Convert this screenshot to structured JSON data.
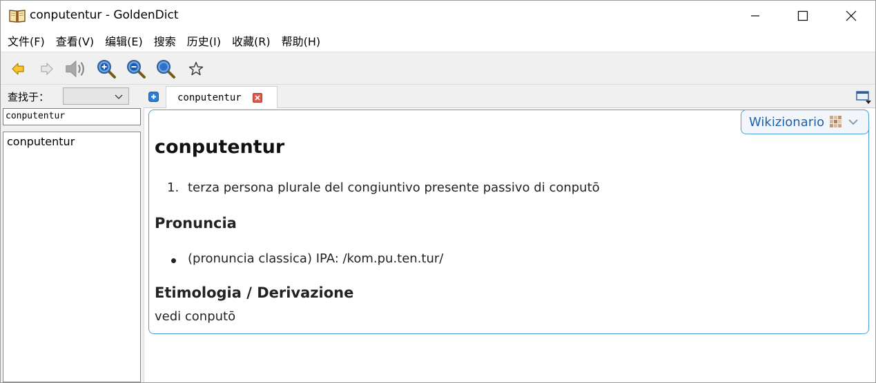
{
  "window": {
    "title": "conputentur - GoldenDict"
  },
  "menu": {
    "items": [
      "文件(F)",
      "查看(V)",
      "编辑(E)",
      "搜索",
      "历史(I)",
      "收藏(R)",
      "帮助(H)"
    ]
  },
  "toolbar": {
    "icons": [
      "back-icon",
      "forward-icon",
      "speaker-icon",
      "zoom-in-icon",
      "zoom-out-icon",
      "zoom-reset-icon",
      "star-icon"
    ]
  },
  "search": {
    "lookin_label": "查找于：",
    "lookin_value": "",
    "query": "conputentur"
  },
  "word_list": {
    "items": [
      "conputentur"
    ]
  },
  "tabs": {
    "items": [
      {
        "label": "conputentur"
      }
    ]
  },
  "article": {
    "dictionary_name": "Wikizionario",
    "headword": "conputentur",
    "definitions": [
      {
        "num": "1.",
        "text": "terza persona plurale del congiuntivo presente passivo di conputō"
      }
    ],
    "pronunciation_heading": "Pronuncia",
    "pronunciation_items": [
      "(pronuncia classica) IPA: /kom.pu.ten.tur/"
    ],
    "etymology_heading": "Etimologia / Derivazione",
    "etymology_text": "vedi conputō"
  },
  "colors": {
    "accent_border": "#4a9fd6",
    "dict_name": "#1f5fa8",
    "toolbar_bg": "#f0f0f0"
  }
}
